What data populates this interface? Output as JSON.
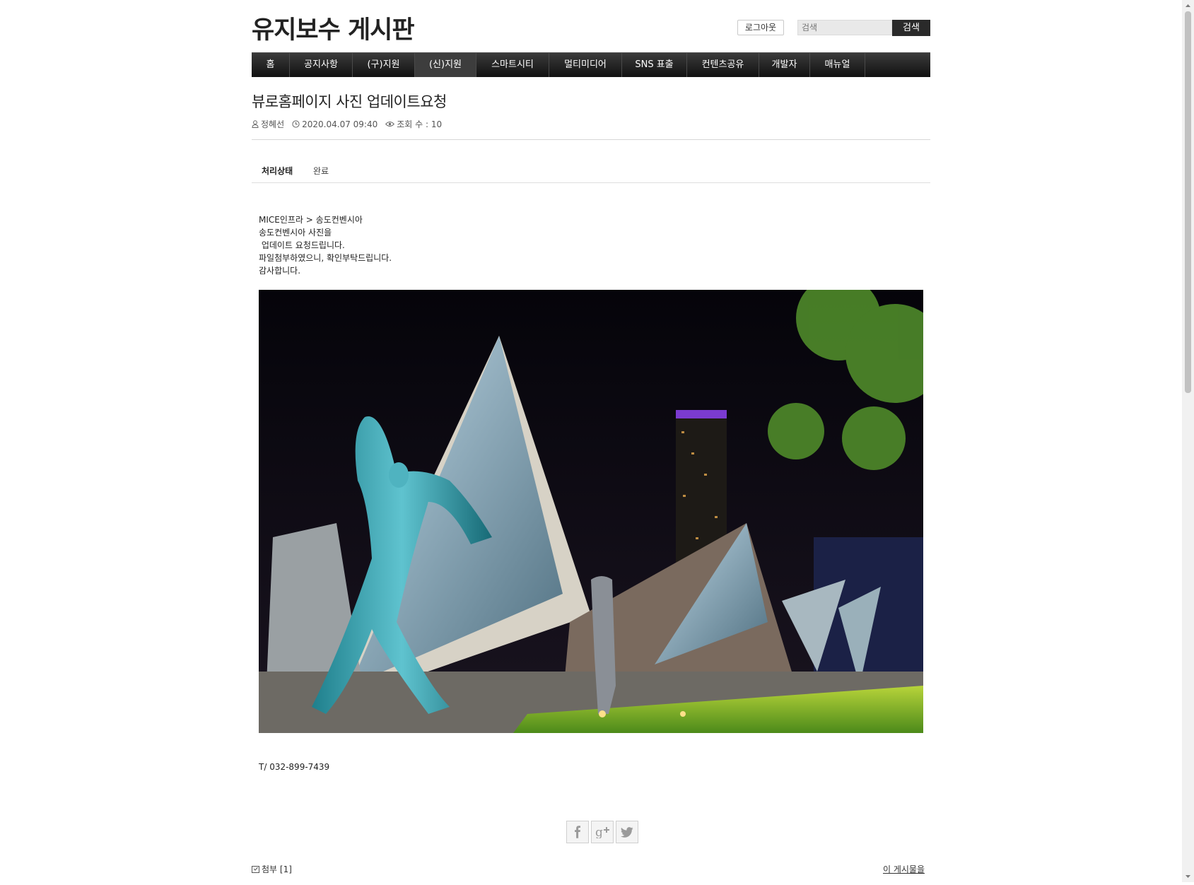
{
  "header": {
    "site_title": "유지보수 게시판",
    "logout_label": "로그아웃",
    "search_placeholder": "검색",
    "search_button": "검색"
  },
  "nav": {
    "items": [
      {
        "label": "홈"
      },
      {
        "label": "공지사항"
      },
      {
        "label": "(구)지원"
      },
      {
        "label": "(신)지원"
      },
      {
        "label": "스마트시티"
      },
      {
        "label": "멀티미디어"
      },
      {
        "label": "SNS 표출"
      },
      {
        "label": "컨텐츠공유"
      },
      {
        "label": "개발자"
      },
      {
        "label": "매뉴얼"
      }
    ],
    "active_index": 3
  },
  "post": {
    "title": "뷰로홈페이지 사진 업데이트요청",
    "author": "정혜선",
    "datetime": "2020.04.07 09:40",
    "views": "조회 수 : 10",
    "status_label": "처리상태",
    "status_value": "완료",
    "body_lines": [
      "MICE인프라 > 송도컨벤시아",
      "송도컨벤시아 사진을",
      "",
      " 업데이트 요청드립니다.",
      "파일첨부하였으니, 확인부탁드립니다.",
      "감사합니다."
    ],
    "phone": "T/ 032-899-7439",
    "attachments": "첨부 [1]",
    "this_post_label": "이 게시물을"
  },
  "share": {
    "icons": [
      "facebook-icon",
      "google-plus-icon",
      "twitter-icon"
    ]
  },
  "colors": {
    "nav_bg": "#1a1a1a",
    "search_button_bg": "#2a2a2a",
    "text": "#222222"
  }
}
